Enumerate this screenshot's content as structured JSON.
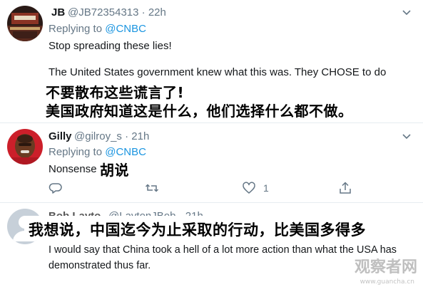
{
  "tweets": [
    {
      "name": "JB",
      "handle": "@JB72354313",
      "time": "22h",
      "replying_prefix": "Replying to",
      "replying_to": "@CNBC",
      "lines": [
        "Stop spreading these lies!",
        "The United States government knew what this was. They CHOSE to do"
      ],
      "caption_lines": [
        "不要散布这些谎言了!",
        "美国政府知道这是什么，他们选择什么都不做。"
      ]
    },
    {
      "name": "Gilly",
      "handle": "@gilroy_s",
      "time": "21h",
      "replying_prefix": "Replying to",
      "replying_to": "@CNBC",
      "text": "Nonsense",
      "caption": "胡说",
      "actions": {
        "reply_count": "",
        "retweet_count": "",
        "like_count": "1"
      }
    },
    {
      "name": "Bob Layto",
      "handle": "@LaytonJBob",
      "time": "21h",
      "caption": "我想说，中国迄今为止采取的行动，比美国多得多",
      "lines": [
        "I would say that China took a hell of a lot more action than what the USA has",
        "demonstrated thus far."
      ]
    }
  ],
  "watermark": {
    "main": "观察者网",
    "sub": "www.guancha.cn"
  }
}
